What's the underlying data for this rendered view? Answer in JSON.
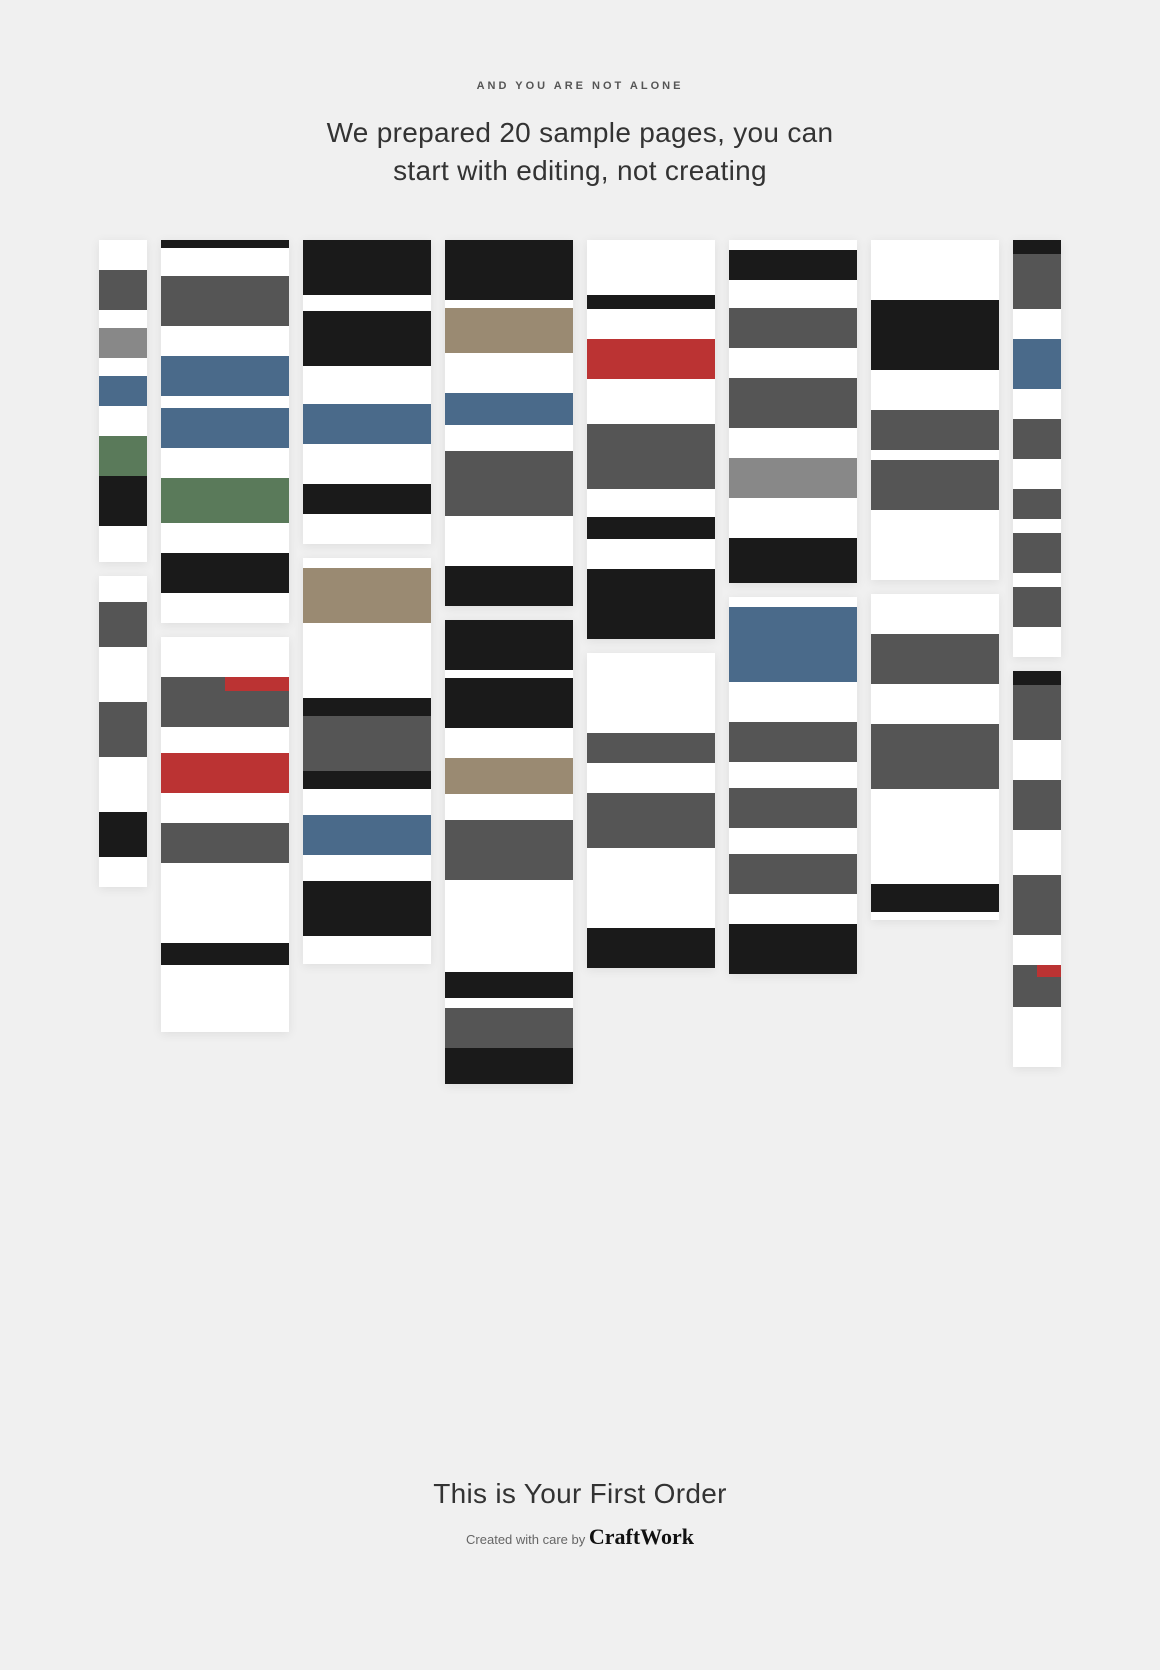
{
  "header": {
    "overline": "AND YOU ARE NOT ALONE",
    "heading_line1": "We prepared 20 sample pages, you can",
    "heading_line2": "start with editing, not creating"
  },
  "footer": {
    "title": "This is Your First Order",
    "sub_prefix": "Created with care by ",
    "brand": "CraftWork"
  }
}
